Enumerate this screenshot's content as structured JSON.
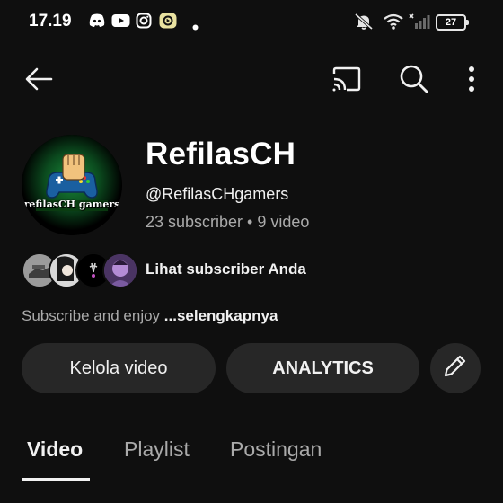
{
  "status_bar": {
    "time": "17.19",
    "battery": "27",
    "icons": [
      "discord-icon",
      "youtube-icon",
      "instagram-icon",
      "app-icon",
      "dot-icon",
      "mute-icon",
      "wifi-icon",
      "signal-icon",
      "battery-icon"
    ]
  },
  "app_bar": {
    "icons": [
      "back-arrow-icon",
      "cast-icon",
      "search-icon",
      "more-vert-icon"
    ]
  },
  "channel": {
    "name": "RefilasCH",
    "handle": "@RefilasCHgamers",
    "stats": "23 subscriber • 9 video",
    "avatar_text": "refilasCH gamers",
    "subscribers_link": "Lihat subscriber Anda",
    "description": "Subscribe and enjoy",
    "description_more": "...selengkapnya"
  },
  "actions": {
    "manage_videos": "Kelola video",
    "analytics": "ANALYTICS",
    "edit_icon": "pencil-icon"
  },
  "tabs": [
    {
      "label": "Video",
      "active": true
    },
    {
      "label": "Playlist",
      "active": false
    },
    {
      "label": "Postingan",
      "active": false
    }
  ],
  "colors": {
    "background": "#0f0f0f",
    "pill": "#272727",
    "muted_text": "#aaaaaa",
    "text": "#f1f1f1"
  }
}
